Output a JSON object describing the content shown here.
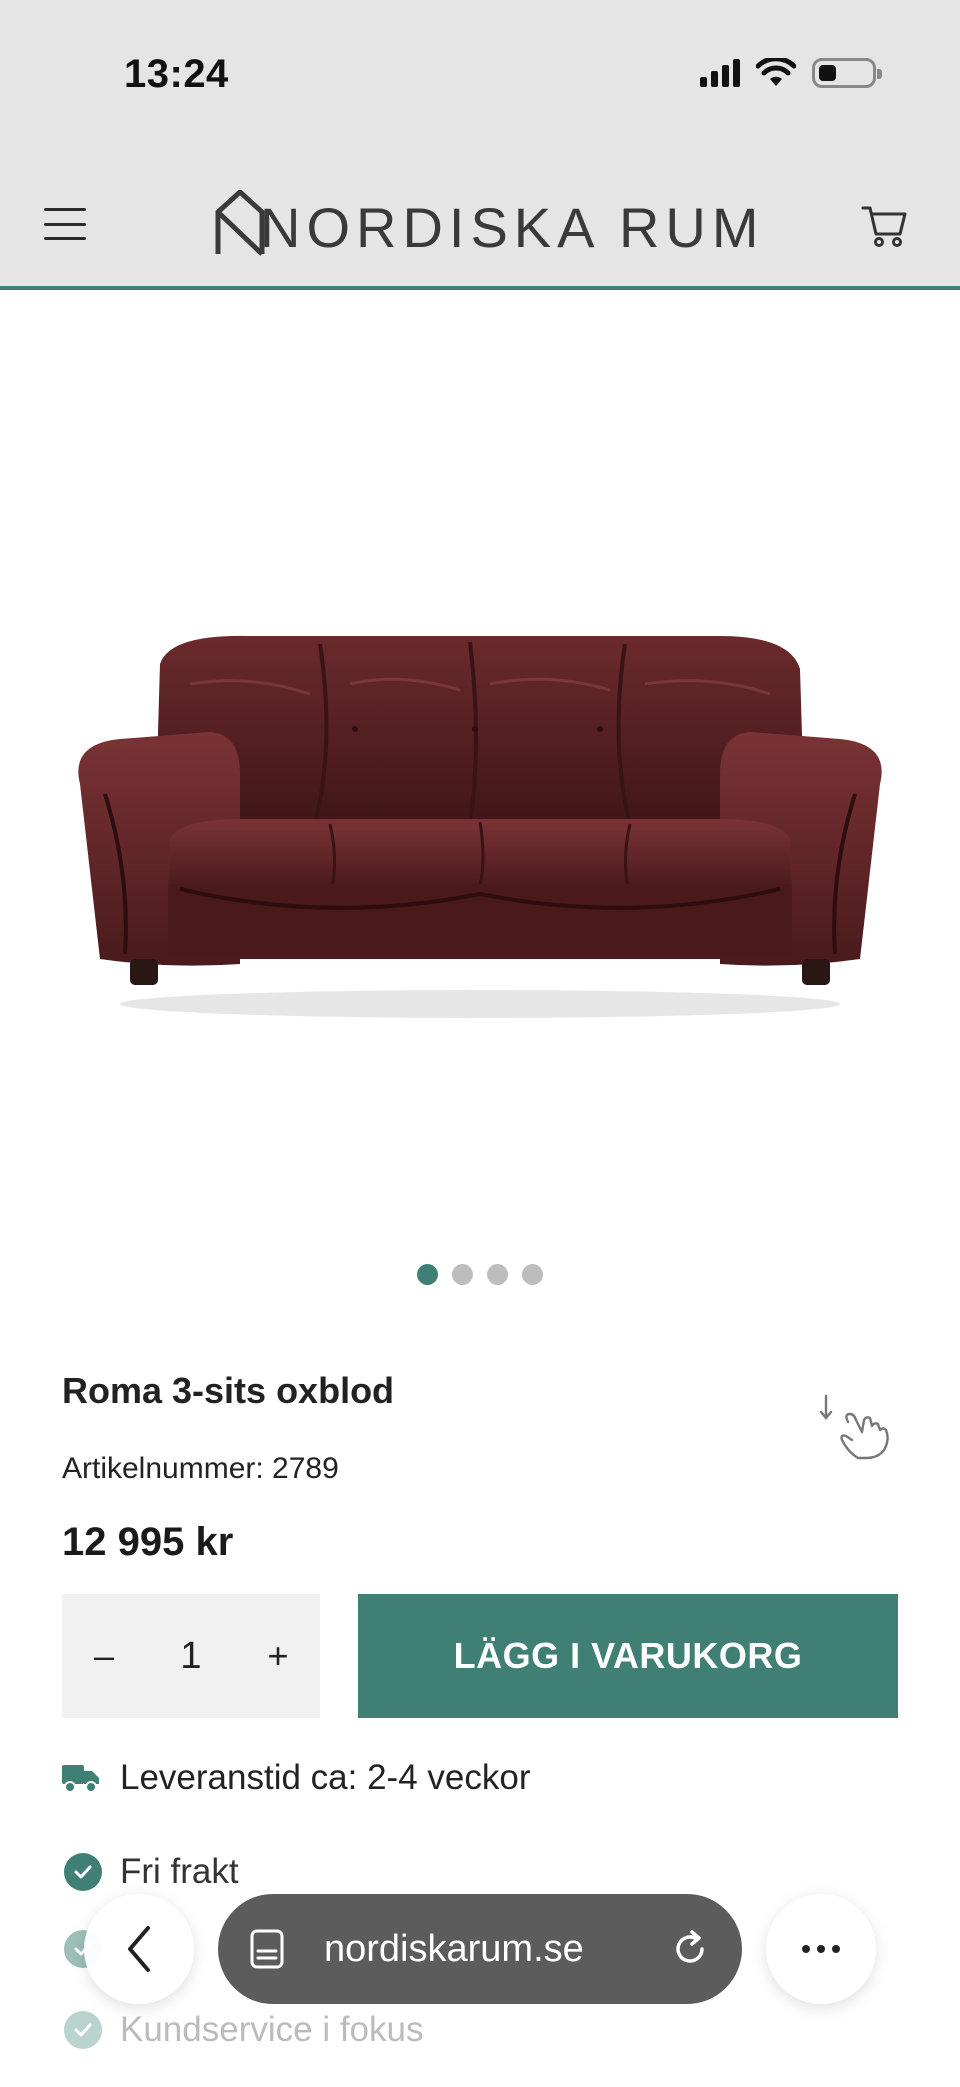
{
  "status_bar": {
    "time": "13:24",
    "battery_level": 0.3
  },
  "header": {
    "brand": "NORDISKA RUM",
    "menu_icon": "hamburger-icon",
    "cart_icon": "cart-icon"
  },
  "gallery": {
    "image": "sofa-photo",
    "slide_count": 4,
    "active_slide": 1
  },
  "product": {
    "title": "Roma 3-sits oxblod",
    "sku_label": "Artikelnummer: 2789",
    "price": "12 995 kr",
    "quantity": "1",
    "qty_minus": "–",
    "qty_plus": "+",
    "add_to_cart": "LÄGG I VARUKORG",
    "delivery": "Leveranstid ca: 2-4 veckor"
  },
  "usps": [
    "Fri frakt",
    "Kundservice i fokus"
  ],
  "browser": {
    "url": "nordiskarum.se"
  },
  "colors": {
    "accent": "#3f7f74",
    "header_bg": "#e5e5e5"
  }
}
